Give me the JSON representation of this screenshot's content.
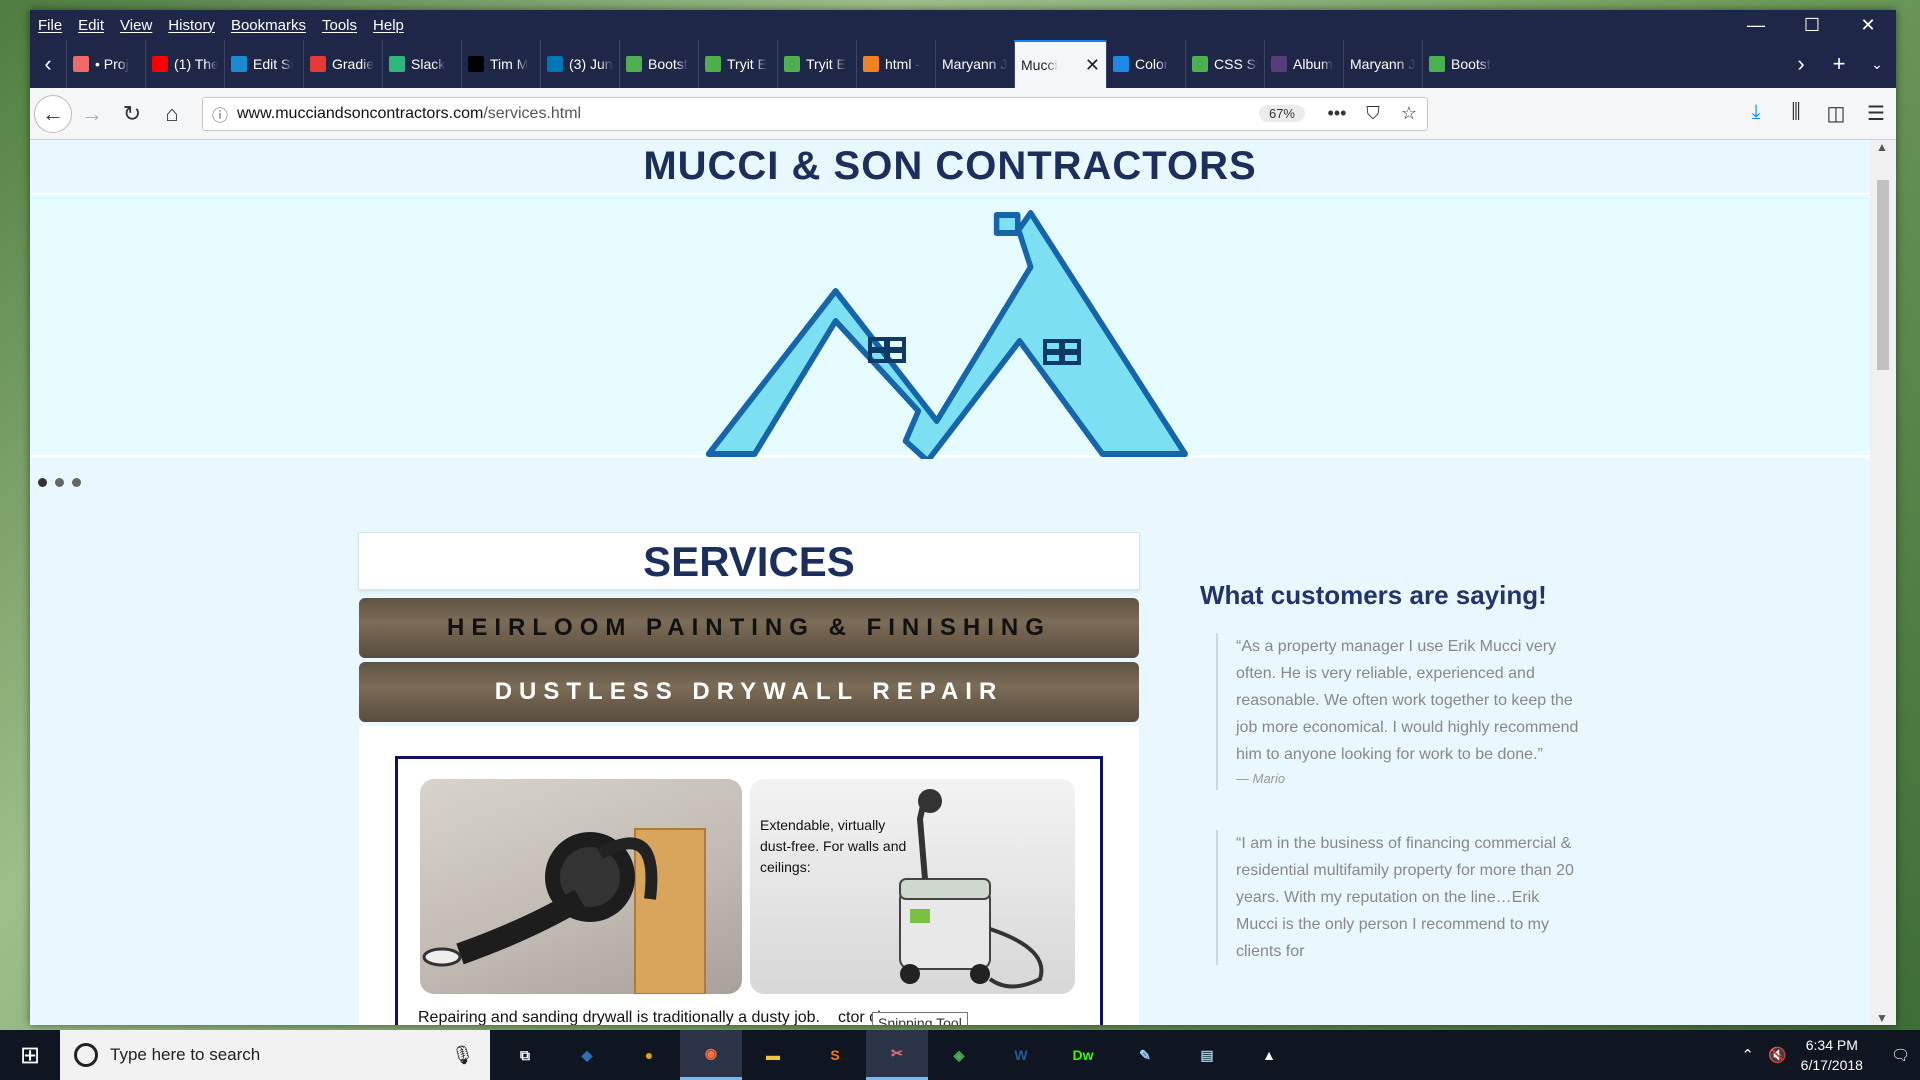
{
  "menu": [
    "File",
    "Edit",
    "View",
    "History",
    "Bookmarks",
    "Tools",
    "Help"
  ],
  "window_controls": {
    "minimize": "—",
    "maximize": "☐",
    "close": "✕"
  },
  "tabs": [
    {
      "label": "• Proj",
      "icon": "asana-icon",
      "color": "#f06a6a"
    },
    {
      "label": "(1) The",
      "icon": "youtube-icon",
      "color": "#ff0000"
    },
    {
      "label": "Edit Si",
      "icon": "edit-icon",
      "color": "#1b8ad4"
    },
    {
      "label": "Gradie",
      "icon": "gradient-icon",
      "color": "#e53935"
    },
    {
      "label": "Slack",
      "icon": "slack-icon",
      "color": "#2eb67d"
    },
    {
      "label": "Tim M",
      "icon": "github-icon",
      "color": "#000000"
    },
    {
      "label": "(3) Jun",
      "icon": "linkedin-icon",
      "color": "#0077b5"
    },
    {
      "label": "Bootst",
      "icon": "w3schools-icon",
      "color": "#4caf50"
    },
    {
      "label": "Tryit E",
      "icon": "w3schools-icon",
      "color": "#4caf50"
    },
    {
      "label": "Tryit E",
      "icon": "w3schools-icon",
      "color": "#4caf50"
    },
    {
      "label": "html -",
      "icon": "stackoverflow-icon",
      "color": "#f48024"
    },
    {
      "label": "Maryann Jo",
      "icon": "none",
      "color": ""
    },
    {
      "label": "Mucci",
      "icon": "none",
      "color": "",
      "active": true
    },
    {
      "label": "Color",
      "icon": "color-icon",
      "color": "#1e88e5"
    },
    {
      "label": "CSS St",
      "icon": "w3schools-icon",
      "color": "#4caf50"
    },
    {
      "label": "Album",
      "icon": "bootstrap-icon",
      "color": "#563d7c"
    },
    {
      "label": "Maryann Jo",
      "icon": "none",
      "color": ""
    },
    {
      "label": "Bootst",
      "icon": "w3schools-icon",
      "color": "#4caf50"
    }
  ],
  "url": {
    "host": "www.mucciandsoncontractors.com",
    "path": "/services.html",
    "zoom": "67%"
  },
  "page": {
    "site_title": "MUCCI & SON CONTRACTORS",
    "services_heading": "SERVICES",
    "service_buttons": [
      "HEIRLOOM PAINTING & FINISHING",
      "DUSTLESS DRYWALL REPAIR"
    ],
    "image_caption": "Extendable, virtually dust-free. For walls and ceilings:",
    "service_text": "Repairing and sanding drywall is traditionally a dusty job.",
    "service_text_end": "ctor cleans up",
    "testimonials_heading": "What customers are saying!",
    "testimonials": [
      {
        "quote": "“As a property manager I use Erik Mucci very often. He is very reliable, experienced and reasonable. We often work together to keep the job more economical. I would highly recommend him to anyone looking for work to be done.”",
        "author": "— Mario"
      },
      {
        "quote": "“I am in the business of financing commercial & residential multifamily property for more than 20 years. With my reputation on the line…Erik Mucci is the only person I recommend to my clients for",
        "author": ""
      }
    ],
    "carousel_slides": 3,
    "active_slide": 1
  },
  "tooltip": "Snipping Tool",
  "taskbar": {
    "search_placeholder": "Type here to search",
    "apps": [
      {
        "name": "task-view",
        "glyph": "⧉",
        "color": "#ffffff"
      },
      {
        "name": "mysql-workbench",
        "glyph": "◆",
        "color": "#2f6eb5"
      },
      {
        "name": "chrome",
        "glyph": "●",
        "color": "#e0a800"
      },
      {
        "name": "firefox",
        "glyph": "◉",
        "color": "#ff7139",
        "active": true
      },
      {
        "name": "file-explorer",
        "glyph": "▬",
        "color": "#f5c542"
      },
      {
        "name": "sublime-text",
        "glyph": "S",
        "color": "#f57c00"
      },
      {
        "name": "snipping-tool",
        "glyph": "✂",
        "color": "#e57373",
        "active": true
      },
      {
        "name": "gitkraken",
        "glyph": "◈",
        "color": "#4caf50"
      },
      {
        "name": "word",
        "glyph": "W",
        "color": "#2b579a"
      },
      {
        "name": "dreamweaver",
        "glyph": "Dw",
        "color": "#35fa00"
      },
      {
        "name": "paint",
        "glyph": "✎",
        "color": "#9bd0f5"
      },
      {
        "name": "notes",
        "glyph": "▤",
        "color": "#8ecae6"
      },
      {
        "name": "photos",
        "glyph": "▲",
        "color": "#ffffff"
      }
    ],
    "time": "6:34 PM",
    "date": "6/17/2018"
  },
  "colors": {
    "title": "#1c2f5c",
    "logo_fill": "#7de0f2",
    "logo_stroke": "#1565a8",
    "frame": "#10106b",
    "testimonial_heading": "#23336b"
  }
}
